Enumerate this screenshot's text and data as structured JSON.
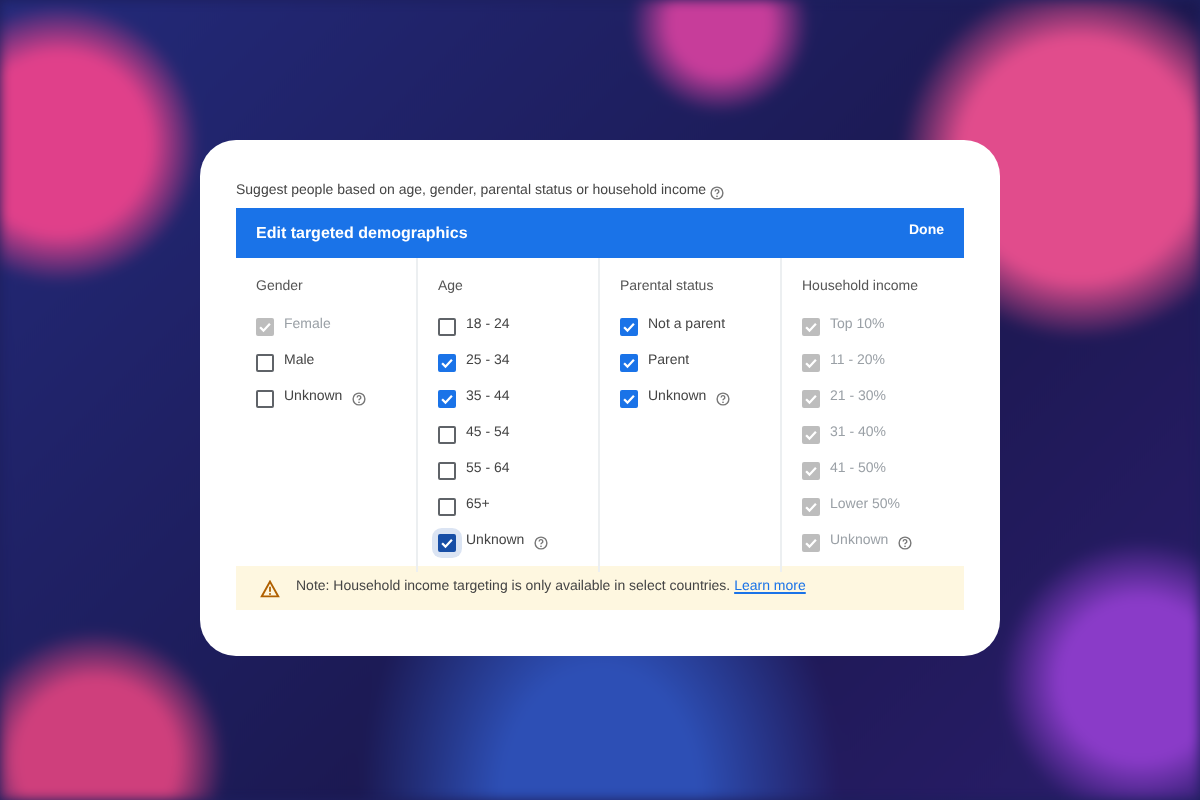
{
  "intro": {
    "text": "Suggest people based on age, gender, parental status or household income",
    "help": true
  },
  "header": {
    "title": "Edit targeted demographics",
    "done": "Done"
  },
  "columns": [
    {
      "heading": "Gender",
      "options": [
        {
          "label": "Female",
          "checked": true,
          "disabled": true
        },
        {
          "label": "Male",
          "checked": false,
          "disabled": false
        },
        {
          "label": "Unknown",
          "checked": false,
          "disabled": false,
          "help": true
        }
      ]
    },
    {
      "heading": "Age",
      "options": [
        {
          "label": "18 - 24",
          "checked": false,
          "disabled": false
        },
        {
          "label": "25 - 34",
          "checked": true,
          "disabled": false
        },
        {
          "label": "35 - 44",
          "checked": true,
          "disabled": false
        },
        {
          "label": "45 - 54",
          "checked": false,
          "disabled": false
        },
        {
          "label": "55 - 64",
          "checked": false,
          "disabled": false
        },
        {
          "label": "65+",
          "checked": false,
          "disabled": false
        },
        {
          "label": "Unknown",
          "checked": true,
          "disabled": false,
          "help": true,
          "focused": true
        }
      ]
    },
    {
      "heading": "Parental status",
      "options": [
        {
          "label": "Not a parent",
          "checked": true,
          "disabled": false
        },
        {
          "label": "Parent",
          "checked": true,
          "disabled": false
        },
        {
          "label": "Unknown",
          "checked": true,
          "disabled": false,
          "help": true
        }
      ]
    },
    {
      "heading": "Household income",
      "options": [
        {
          "label": "Top 10%",
          "checked": true,
          "disabled": true
        },
        {
          "label": "11 - 20%",
          "checked": true,
          "disabled": true
        },
        {
          "label": "21 - 30%",
          "checked": true,
          "disabled": true
        },
        {
          "label": "31 - 40%",
          "checked": true,
          "disabled": true
        },
        {
          "label": "41 - 50%",
          "checked": true,
          "disabled": true
        },
        {
          "label": "Lower 50%",
          "checked": true,
          "disabled": true
        },
        {
          "label": "Unknown",
          "checked": true,
          "disabled": true,
          "help": true
        }
      ]
    }
  ],
  "note": {
    "text": "Note: Household income targeting is only available in select countries.",
    "link": "Learn more"
  }
}
